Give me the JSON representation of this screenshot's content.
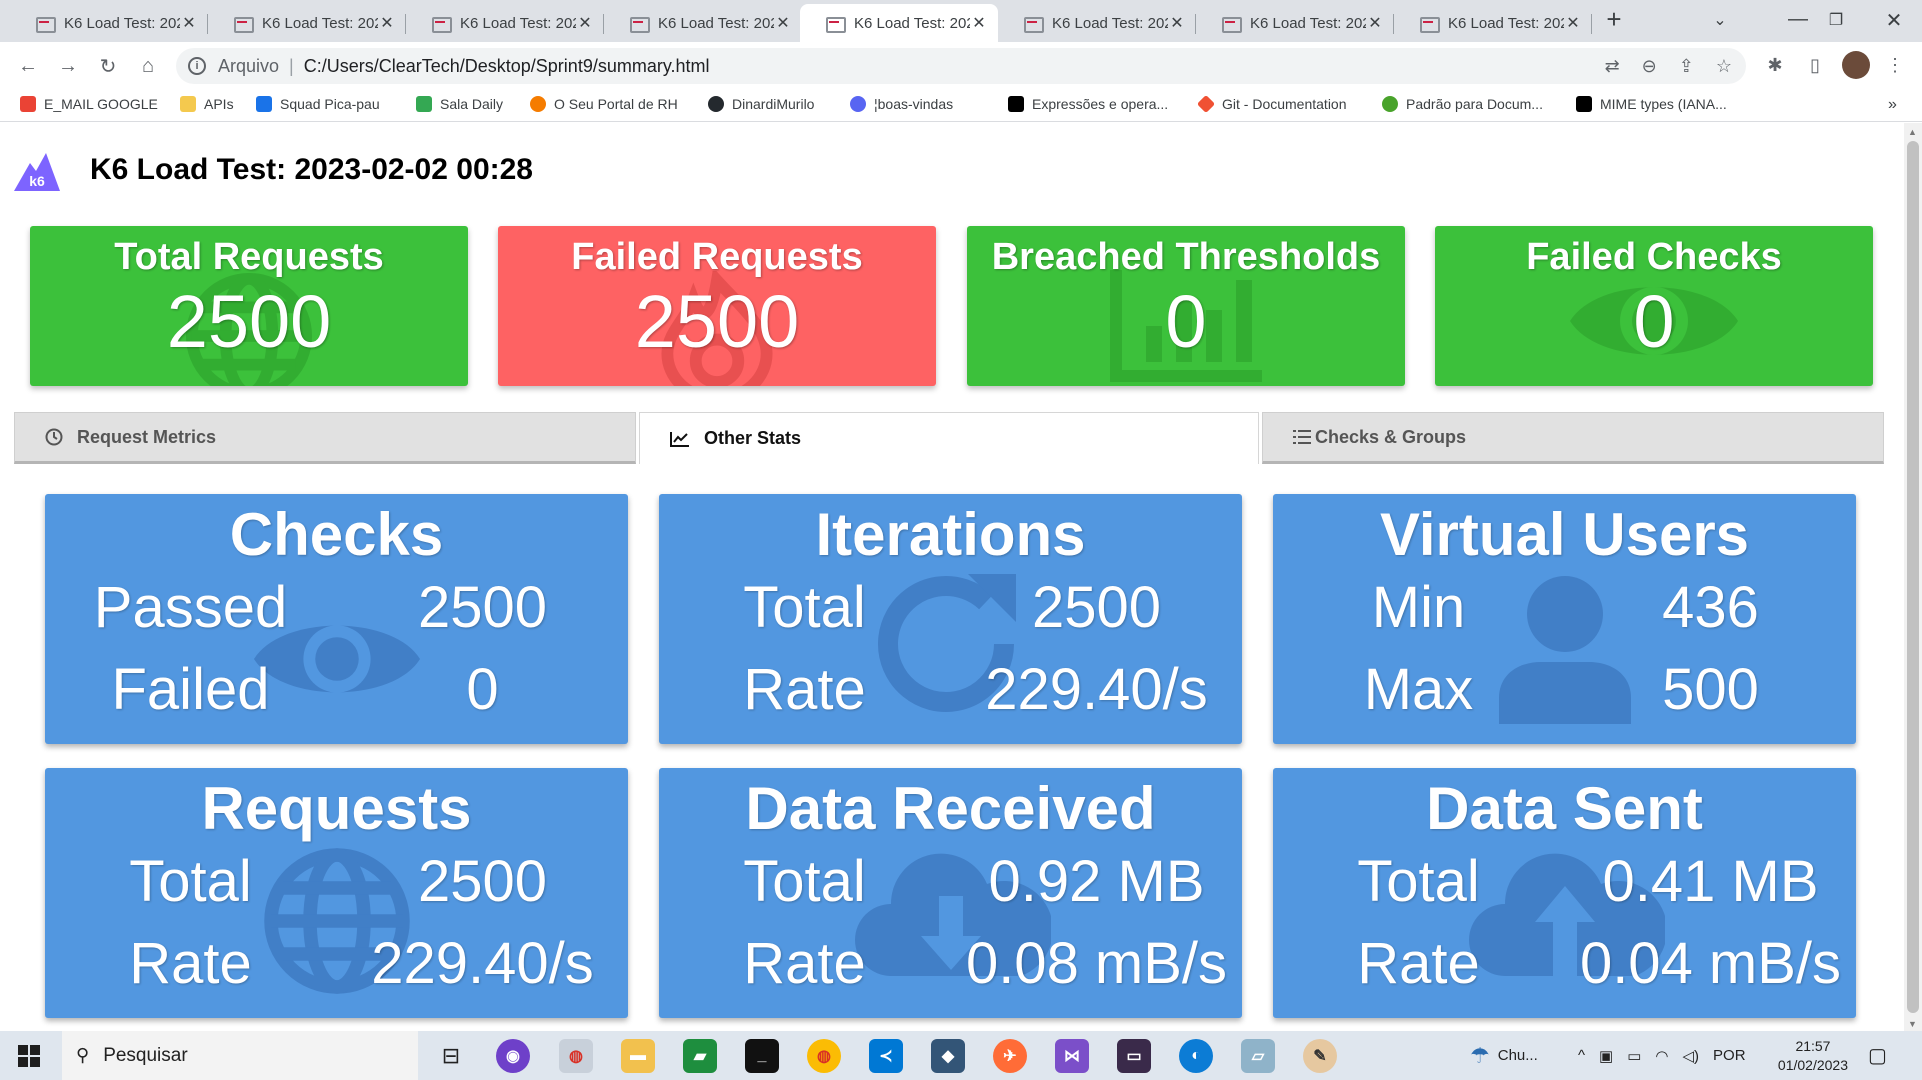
{
  "browser": {
    "tabs": [
      {
        "title": "K6 Load Test: 202",
        "active": false
      },
      {
        "title": "K6 Load Test: 202",
        "active": false
      },
      {
        "title": "K6 Load Test: 202",
        "active": false
      },
      {
        "title": "K6 Load Test: 202",
        "active": false
      },
      {
        "title": "K6 Load Test: 202",
        "active": true
      },
      {
        "title": "K6 Load Test: 202",
        "active": false
      },
      {
        "title": "K6 Load Test: 202",
        "active": false
      },
      {
        "title": "K6 Load Test: 202",
        "active": false
      }
    ],
    "address": {
      "scheme": "Arquivo",
      "url": "C:/Users/ClearTech/Desktop/Sprint9/summary.html"
    },
    "bookmarks": [
      {
        "label": "E_MAIL GOOGLE",
        "icon": "gmail-icon",
        "color": "#ea4335"
      },
      {
        "label": "APIs",
        "icon": "folder-icon",
        "color": "#f4c94e"
      },
      {
        "label": "Squad Pica-pau",
        "icon": "teams-icon",
        "color": "#1a73e8"
      },
      {
        "label": "Sala Daily",
        "icon": "meet-icon",
        "color": "#34a853"
      },
      {
        "label": "O Seu Portal de RH",
        "icon": "portal-icon",
        "color": "#f57c00"
      },
      {
        "label": "DinardiMurilo",
        "icon": "github-icon",
        "color": "#24292e"
      },
      {
        "label": "¦boas-vindas",
        "icon": "discord-icon",
        "color": "#5865f2"
      },
      {
        "label": "Expressões e opera...",
        "icon": "mdn-icon",
        "color": "#000000"
      },
      {
        "label": "Git - Documentation",
        "icon": "git-icon",
        "color": "#f05133"
      },
      {
        "label": "Padrão para Docum...",
        "icon": "swagger-icon",
        "color": "#49a32b"
      },
      {
        "label": "MIME types (IANA...",
        "icon": "mdn-icon",
        "color": "#000000"
      }
    ]
  },
  "report": {
    "title": "K6 Load Test: 2023-02-02 00:28",
    "summary": [
      {
        "label": "Total Requests",
        "value": "2500",
        "color": "green",
        "icon": "globe-icon"
      },
      {
        "label": "Failed Requests",
        "value": "2500",
        "color": "red",
        "icon": "fire-icon"
      },
      {
        "label": "Breached Thresholds",
        "value": "0",
        "color": "green",
        "icon": "chart-icon"
      },
      {
        "label": "Failed Checks",
        "value": "0",
        "color": "green",
        "icon": "eye-icon"
      }
    ],
    "tabs": [
      {
        "label": "Request Metrics",
        "icon": "clock-icon",
        "active": false
      },
      {
        "label": "Other Stats",
        "icon": "line-chart-icon",
        "active": true
      },
      {
        "label": "Checks & Groups",
        "icon": "list-icon",
        "active": false
      }
    ],
    "stats": [
      {
        "title": "Checks",
        "icon": "eye-icon",
        "rows": [
          {
            "k": "Passed",
            "v": "2500"
          },
          {
            "k": "Failed",
            "v": "0"
          }
        ]
      },
      {
        "title": "Iterations",
        "icon": "refresh-icon",
        "rows": [
          {
            "k": "Total",
            "v": "2500"
          },
          {
            "k": "Rate",
            "v": "229.40/s"
          }
        ]
      },
      {
        "title": "Virtual Users",
        "icon": "user-icon",
        "rows": [
          {
            "k": "Min",
            "v": "436"
          },
          {
            "k": "Max",
            "v": "500"
          }
        ]
      },
      {
        "title": "Requests",
        "icon": "globe-icon",
        "rows": [
          {
            "k": "Total",
            "v": "2500"
          },
          {
            "k": "Rate",
            "v": "229.40/s"
          }
        ]
      },
      {
        "title": "Data Received",
        "icon": "cloud-download-icon",
        "rows": [
          {
            "k": "Total",
            "v": "0.92 MB"
          },
          {
            "k": "Rate",
            "v": "0.08 mB/s"
          }
        ]
      },
      {
        "title": "Data Sent",
        "icon": "cloud-upload-icon",
        "rows": [
          {
            "k": "Total",
            "v": "0.41 MB"
          },
          {
            "k": "Rate",
            "v": "0.04 mB/s"
          }
        ]
      }
    ]
  },
  "taskbar": {
    "search_placeholder": "Pesquisar",
    "weather": "Chu...",
    "language": "POR",
    "time": "21:57",
    "date": "01/02/2023"
  },
  "colors": {
    "green": "#3cc13b",
    "red": "#fe6263",
    "blue": "#5297e0"
  }
}
